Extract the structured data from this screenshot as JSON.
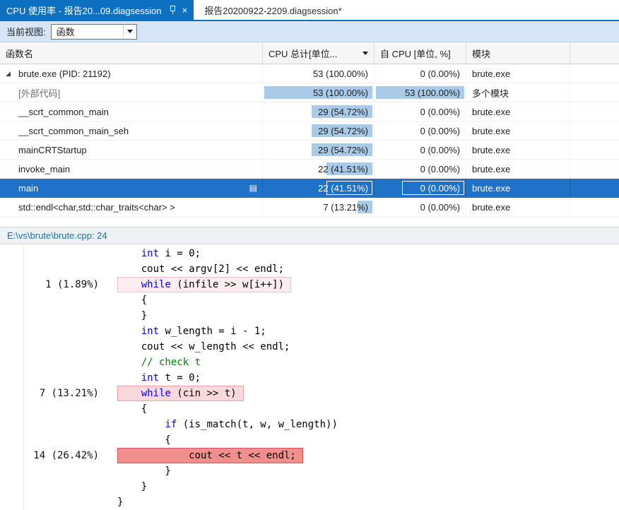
{
  "colors": {
    "accent": "#0E70C0",
    "selection": "#2072C8",
    "bar": "#A9CBE8",
    "toolbar_bg": "#D7E6F7",
    "link": "#1B6FA8",
    "keyword": "#0000FF",
    "comment": "#008000",
    "hl_light_bg": "#FCEEF0",
    "hl_light_border": "#F0C0C6",
    "hl_med_bg": "#FAD8DC",
    "hl_med_border": "#EBA3AB",
    "hl_hot_bg": "#F08F8D",
    "hl_hot_border": "#D9534F"
  },
  "tabs": [
    {
      "title": "CPU 使用率 - 报告20...09.diagsession",
      "active": true
    },
    {
      "title": "报告20200922-2209.diagsession*",
      "active": false
    }
  ],
  "toolbar": {
    "current_view_label": "当前视图:",
    "view_value": "函数"
  },
  "table": {
    "headers": [
      {
        "label": "函数名"
      },
      {
        "label": "CPU 总计[单位...",
        "dropdown": true
      },
      {
        "label": "自 CPU [单位, %]"
      },
      {
        "label": "模块"
      }
    ],
    "rows": [
      {
        "name": "brute.exe (PID: 21192)",
        "level": 0,
        "expanded": true,
        "cpu_total": "53 (100.00%)",
        "cpu_total_bar": 0,
        "self_cpu": "0 (0.00%)",
        "self_cpu_bar": 0,
        "module": "brute.exe"
      },
      {
        "name": "[外部代码]",
        "level": 1,
        "dim": true,
        "cpu_total": "53 (100.00%)",
        "cpu_total_bar": 100,
        "self_cpu": "53 (100.00%)",
        "self_cpu_bar": 100,
        "module": "多个模块"
      },
      {
        "name": "__scrt_common_main",
        "level": 1,
        "cpu_total": "29 (54.72%)",
        "cpu_total_bar": 54.72,
        "self_cpu": "0 (0.00%)",
        "self_cpu_bar": 0,
        "module": "brute.exe"
      },
      {
        "name": "__scrt_common_main_seh",
        "level": 1,
        "cpu_total": "29 (54.72%)",
        "cpu_total_bar": 54.72,
        "self_cpu": "0 (0.00%)",
        "self_cpu_bar": 0,
        "module": "brute.exe"
      },
      {
        "name": "mainCRTStartup",
        "level": 1,
        "cpu_total": "29 (54.72%)",
        "cpu_total_bar": 54.72,
        "self_cpu": "0 (0.00%)",
        "self_cpu_bar": 0,
        "module": "brute.exe"
      },
      {
        "name": "invoke_main",
        "level": 1,
        "cpu_total": "22 (41.51%)",
        "cpu_total_bar": 41.51,
        "self_cpu": "0 (0.00%)",
        "self_cpu_bar": 0,
        "module": "brute.exe"
      },
      {
        "name": "main",
        "level": 1,
        "selected": true,
        "hot_icon": true,
        "cpu_total": "22 (41.51%)",
        "cpu_total_bar": 41.51,
        "self_cpu": "0 (0.00%)",
        "self_cpu_bar": 0,
        "module": "brute.exe"
      },
      {
        "name": "std::endl<char,std::char_traits<char> >",
        "level": 1,
        "cpu_total": "7 (13.21%)",
        "cpu_total_bar": 13.21,
        "self_cpu": "0 (0.00%)",
        "self_cpu_bar": 0,
        "module": "brute.exe"
      }
    ]
  },
  "source": {
    "path": "E:\\vs\\brute\\brute.cpp: 24",
    "lines": [
      {
        "ann": "",
        "hl": "",
        "segs": [
          [
            "p",
            "    "
          ],
          [
            "k",
            "int"
          ],
          [
            "p",
            " i = 0;"
          ]
        ]
      },
      {
        "ann": "",
        "hl": "",
        "segs": [
          [
            "p",
            "    cout << argv[2] << endl;"
          ]
        ]
      },
      {
        "ann": "1 (1.89%)",
        "hl": "light",
        "segs": [
          [
            "p",
            "    "
          ],
          [
            "k",
            "while"
          ],
          [
            "p",
            " (infile >> w[i++])"
          ]
        ]
      },
      {
        "ann": "",
        "hl": "",
        "segs": [
          [
            "p",
            "    {"
          ]
        ]
      },
      {
        "ann": "",
        "hl": "",
        "segs": [
          [
            "p",
            "    }"
          ]
        ]
      },
      {
        "ann": "",
        "hl": "",
        "segs": [
          [
            "p",
            "    "
          ],
          [
            "k",
            "int"
          ],
          [
            "p",
            " w_length = i - 1;"
          ]
        ]
      },
      {
        "ann": "",
        "hl": "",
        "segs": [
          [
            "p",
            "    cout << w_length << endl;"
          ]
        ]
      },
      {
        "ann": "",
        "hl": "",
        "segs": [
          [
            "c",
            "    // check t"
          ]
        ]
      },
      {
        "ann": "",
        "hl": "",
        "segs": [
          [
            "p",
            "    "
          ],
          [
            "k",
            "int"
          ],
          [
            "p",
            " t = 0;"
          ]
        ]
      },
      {
        "ann": "7 (13.21%)",
        "hl": "med",
        "segs": [
          [
            "p",
            "    "
          ],
          [
            "k",
            "while"
          ],
          [
            "p",
            " (cin >> t)"
          ]
        ]
      },
      {
        "ann": "",
        "hl": "",
        "segs": [
          [
            "p",
            "    {"
          ]
        ]
      },
      {
        "ann": "",
        "hl": "",
        "segs": [
          [
            "p",
            "        "
          ],
          [
            "k",
            "if"
          ],
          [
            "p",
            " (is_match(t, w, w_length))"
          ]
        ]
      },
      {
        "ann": "",
        "hl": "",
        "segs": [
          [
            "p",
            "        {"
          ]
        ]
      },
      {
        "ann": "14 (26.42%)",
        "hl": "hot",
        "segs": [
          [
            "p",
            "            cout << t << endl;"
          ]
        ]
      },
      {
        "ann": "",
        "hl": "",
        "segs": [
          [
            "p",
            "        }"
          ]
        ]
      },
      {
        "ann": "",
        "hl": "",
        "segs": [
          [
            "p",
            "    }"
          ]
        ]
      },
      {
        "ann": "",
        "hl": "",
        "segs": [
          [
            "p",
            "}"
          ]
        ]
      }
    ]
  }
}
